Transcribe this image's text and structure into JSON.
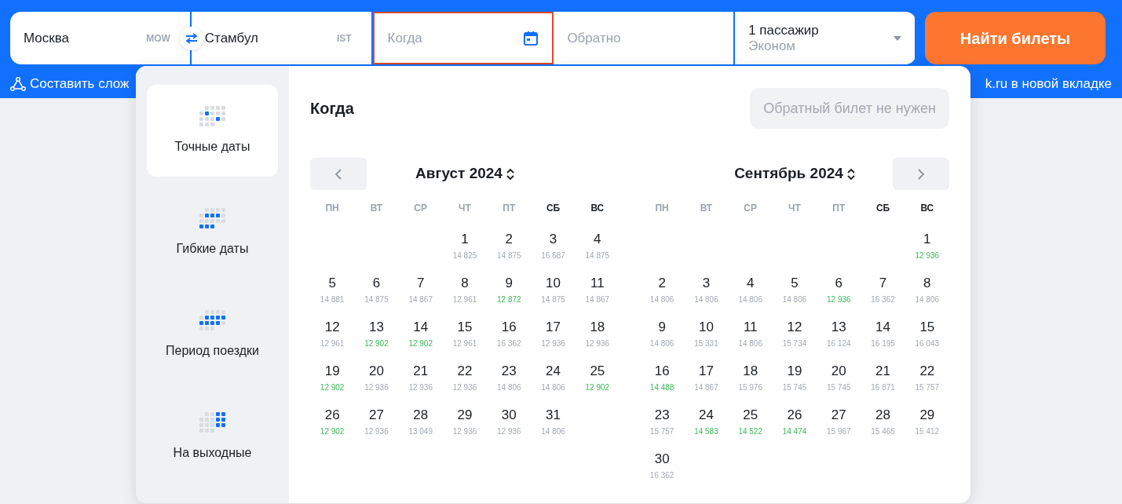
{
  "search_form": {
    "fields": [
      {
        "kind": "city",
        "value": "Москва",
        "code": "MOW"
      },
      {
        "kind": "city",
        "value": "Стамбул",
        "code": "IST"
      },
      {
        "kind": "date",
        "placeholder": "Когда",
        "focused": true
      },
      {
        "kind": "return",
        "placeholder": "Обратно",
        "focused": false
      },
      {
        "kind": "passengers",
        "value": "1 пассажир",
        "subvalue": "Эконом"
      }
    ],
    "submit": "Найти билеты"
  },
  "links": [
    {
      "text": "Составить слож"
    },
    {
      "text": "k.ru в новой вкладке"
    }
  ],
  "date_picker": {
    "modes": [
      {
        "label": "Точные даты",
        "selected": true
      },
      {
        "label": "Гибкие даты",
        "selected": false
      },
      {
        "label": "Период поездки",
        "selected": false
      },
      {
        "label": "На выходные",
        "selected": false
      }
    ],
    "title": "Когда",
    "one_way_button": "Обратный билет не нужен",
    "months": [
      {
        "title": "Август 2024",
        "kind": "prev",
        "weekdays": [
          {
            "label": "ПН",
            "weekend": false
          },
          {
            "label": "ВТ",
            "weekend": false
          },
          {
            "label": "СР",
            "weekend": false
          },
          {
            "label": "ЧТ",
            "weekend": false
          },
          {
            "label": "ПТ",
            "weekend": false
          },
          {
            "label": "СБ",
            "weekend": true
          },
          {
            "label": "ВС",
            "weekend": true
          }
        ],
        "weeks": [
          [
            {
              "kind": "empty"
            },
            {
              "kind": "empty"
            },
            {
              "kind": "empty"
            },
            {
              "kind": "day",
              "day": "1",
              "price": "14 825",
              "cheap": false
            },
            {
              "kind": "day",
              "day": "2",
              "price": "14 875",
              "cheap": false
            },
            {
              "kind": "day",
              "day": "3",
              "price": "16 687",
              "cheap": false
            },
            {
              "kind": "day",
              "day": "4",
              "price": "14 875",
              "cheap": false
            }
          ],
          [
            {
              "kind": "day",
              "day": "5",
              "price": "14 881",
              "cheap": false
            },
            {
              "kind": "day",
              "day": "6",
              "price": "14 875",
              "cheap": false
            },
            {
              "kind": "day",
              "day": "7",
              "price": "14 867",
              "cheap": false
            },
            {
              "kind": "day",
              "day": "8",
              "price": "12 961",
              "cheap": false
            },
            {
              "kind": "day",
              "day": "9",
              "price": "12 872",
              "cheap": true
            },
            {
              "kind": "day",
              "day": "10",
              "price": "14 875",
              "cheap": false
            },
            {
              "kind": "day",
              "day": "11",
              "price": "14 867",
              "cheap": false
            }
          ],
          [
            {
              "kind": "day",
              "day": "12",
              "price": "12 961",
              "cheap": false
            },
            {
              "kind": "day",
              "day": "13",
              "price": "12 902",
              "cheap": true
            },
            {
              "kind": "day",
              "day": "14",
              "price": "12 902",
              "cheap": true
            },
            {
              "kind": "day",
              "day": "15",
              "price": "12 961",
              "cheap": false
            },
            {
              "kind": "day",
              "day": "16",
              "price": "16 362",
              "cheap": false
            },
            {
              "kind": "day",
              "day": "17",
              "price": "12 936",
              "cheap": false
            },
            {
              "kind": "day",
              "day": "18",
              "price": "12 936",
              "cheap": false
            }
          ],
          [
            {
              "kind": "day",
              "day": "19",
              "price": "12 902",
              "cheap": true
            },
            {
              "kind": "day",
              "day": "20",
              "price": "12 936",
              "cheap": false
            },
            {
              "kind": "day",
              "day": "21",
              "price": "12 936",
              "cheap": false
            },
            {
              "kind": "day",
              "day": "22",
              "price": "12 936",
              "cheap": false
            },
            {
              "kind": "day",
              "day": "23",
              "price": "14 806",
              "cheap": false
            },
            {
              "kind": "day",
              "day": "24",
              "price": "14 806",
              "cheap": false
            },
            {
              "kind": "day",
              "day": "25",
              "price": "12 902",
              "cheap": true
            }
          ],
          [
            {
              "kind": "day",
              "day": "26",
              "price": "12 902",
              "cheap": true
            },
            {
              "kind": "day",
              "day": "27",
              "price": "12 936",
              "cheap": false
            },
            {
              "kind": "day",
              "day": "28",
              "price": "13 049",
              "cheap": false
            },
            {
              "kind": "day",
              "day": "29",
              "price": "12 936",
              "cheap": false
            },
            {
              "kind": "day",
              "day": "30",
              "price": "12 936",
              "cheap": false
            },
            {
              "kind": "day",
              "day": "31",
              "price": "14 806",
              "cheap": false
            },
            {
              "kind": "empty"
            }
          ]
        ]
      },
      {
        "title": "Сентябрь 2024",
        "kind": "next",
        "weekdays": [
          {
            "label": "ПН",
            "weekend": false
          },
          {
            "label": "ВТ",
            "weekend": false
          },
          {
            "label": "СР",
            "weekend": false
          },
          {
            "label": "ЧТ",
            "weekend": false
          },
          {
            "label": "ПТ",
            "weekend": false
          },
          {
            "label": "СБ",
            "weekend": true
          },
          {
            "label": "ВС",
            "weekend": true
          }
        ],
        "weeks": [
          [
            {
              "kind": "empty"
            },
            {
              "kind": "empty"
            },
            {
              "kind": "empty"
            },
            {
              "kind": "empty"
            },
            {
              "kind": "empty"
            },
            {
              "kind": "empty"
            },
            {
              "kind": "day",
              "day": "1",
              "price": "12 936",
              "cheap": true
            }
          ],
          [
            {
              "kind": "day",
              "day": "2",
              "price": "14 806",
              "cheap": false
            },
            {
              "kind": "day",
              "day": "3",
              "price": "14 806",
              "cheap": false
            },
            {
              "kind": "day",
              "day": "4",
              "price": "14 806",
              "cheap": false
            },
            {
              "kind": "day",
              "day": "5",
              "price": "14 806",
              "cheap": false
            },
            {
              "kind": "day",
              "day": "6",
              "price": "12 936",
              "cheap": true
            },
            {
              "kind": "day",
              "day": "7",
              "price": "16 362",
              "cheap": false
            },
            {
              "kind": "day",
              "day": "8",
              "price": "14 806",
              "cheap": false
            }
          ],
          [
            {
              "kind": "day",
              "day": "9",
              "price": "14 806",
              "cheap": false
            },
            {
              "kind": "day",
              "day": "10",
              "price": "15 331",
              "cheap": false
            },
            {
              "kind": "day",
              "day": "11",
              "price": "14 806",
              "cheap": false
            },
            {
              "kind": "day",
              "day": "12",
              "price": "15 734",
              "cheap": false
            },
            {
              "kind": "day",
              "day": "13",
              "price": "16 124",
              "cheap": false
            },
            {
              "kind": "day",
              "day": "14",
              "price": "16 195",
              "cheap": false
            },
            {
              "kind": "day",
              "day": "15",
              "price": "16 043",
              "cheap": false
            }
          ],
          [
            {
              "kind": "day",
              "day": "16",
              "price": "14 488",
              "cheap": true
            },
            {
              "kind": "day",
              "day": "17",
              "price": "14 867",
              "cheap": false
            },
            {
              "kind": "day",
              "day": "18",
              "price": "15 976",
              "cheap": false
            },
            {
              "kind": "day",
              "day": "19",
              "price": "15 745",
              "cheap": false
            },
            {
              "kind": "day",
              "day": "20",
              "price": "15 745",
              "cheap": false
            },
            {
              "kind": "day",
              "day": "21",
              "price": "16 871",
              "cheap": false
            },
            {
              "kind": "day",
              "day": "22",
              "price": "15 757",
              "cheap": false
            }
          ],
          [
            {
              "kind": "day",
              "day": "23",
              "price": "15 757",
              "cheap": false
            },
            {
              "kind": "day",
              "day": "24",
              "price": "14 583",
              "cheap": true
            },
            {
              "kind": "day",
              "day": "25",
              "price": "14 522",
              "cheap": true
            },
            {
              "kind": "day",
              "day": "26",
              "price": "14 474",
              "cheap": true
            },
            {
              "kind": "day",
              "day": "27",
              "price": "15 967",
              "cheap": false
            },
            {
              "kind": "day",
              "day": "28",
              "price": "15 465",
              "cheap": false
            },
            {
              "kind": "day",
              "day": "29",
              "price": "15 412",
              "cheap": false
            }
          ],
          [
            {
              "kind": "day",
              "day": "30",
              "price": "16 362",
              "cheap": false
            },
            {
              "kind": "empty"
            },
            {
              "kind": "empty"
            },
            {
              "kind": "empty"
            },
            {
              "kind": "empty"
            },
            {
              "kind": "empty"
            },
            {
              "kind": "empty"
            }
          ]
        ]
      }
    ]
  }
}
